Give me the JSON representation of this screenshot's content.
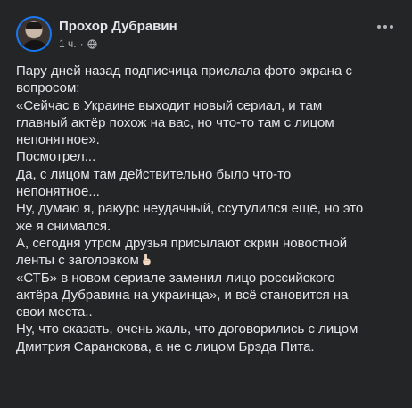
{
  "post": {
    "author": "Прохор Дубравин",
    "time": "1 ч.",
    "separator": "·",
    "lines": [
      "Пару дней назад подписчица прислала фото экрана с",
      "вопросом:",
      "«Сейчас в Украине выходит новый сериал, и там",
      "главный актёр похож на вас, но что-то там с лицом",
      "непонятное».",
      "Посмотрел...",
      "Да, с лицом там действительно было что-то",
      "непонятное...",
      "Ну, думаю я, ракурс неудачный, ссутулился ещё, но это",
      "же я снимался.",
      "А, сегодня утром друзья присылают скрин новостной",
      "ленты с заголовком",
      "«СТБ» в новом сериале заменил лицо российского",
      "актёра Дубравина на украинца», и всё становится на",
      "свои места..",
      "Ну, что сказать, очень жаль, что договорились с лицом",
      "Дмитрия Саранскова, а не с лицом Брэда Пита."
    ],
    "emoji_line": 11,
    "icons": {
      "audience": "globe-icon",
      "menu": "more-options-icon",
      "emoji": "pointing-up-icon"
    }
  },
  "colors": {
    "background": "#242526",
    "text": "#e4e6eb",
    "secondary": "#b0b3b8"
  }
}
